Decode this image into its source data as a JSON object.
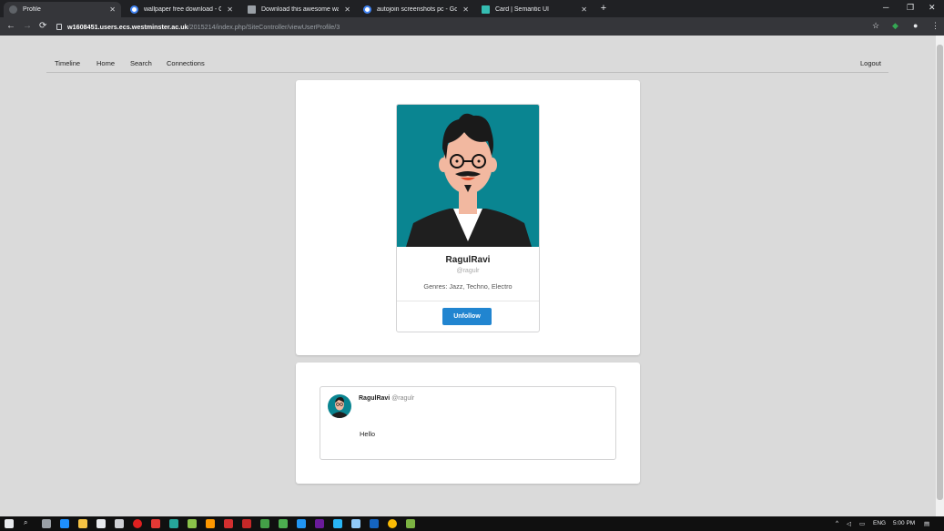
{
  "browser": {
    "tabs": [
      {
        "title": "Profile",
        "active": true
      },
      {
        "title": "wallpaper free download - Goog",
        "active": false
      },
      {
        "title": "Download this awesome wallpap",
        "active": false
      },
      {
        "title": "autojoin screenshots pc - Googl",
        "active": false
      },
      {
        "title": "Card | Semantic UI",
        "active": false
      }
    ],
    "url_host": "w1608451.users.ecs.westminster.ac.uk",
    "url_path": "/2015214/index.php/SiteController/viewUserProfile/3"
  },
  "menu": {
    "items": [
      "Timeline",
      "Home",
      "Search",
      "Connections"
    ],
    "logout": "Logout"
  },
  "profile": {
    "name": "RagulRavi",
    "handle": "@ragulr",
    "genres": "Genres: Jazz, Techno, Electro",
    "button": "Unfollow"
  },
  "post": {
    "user": "RagulRavi",
    "handle": "@ragulr",
    "body": "Hello"
  },
  "taskbar": {
    "lang": "ENG",
    "time": "5:00 PM"
  },
  "colors": {
    "accent": "#2185d0",
    "avatar_bg": "#0a8591",
    "page_bg": "#dadada"
  }
}
